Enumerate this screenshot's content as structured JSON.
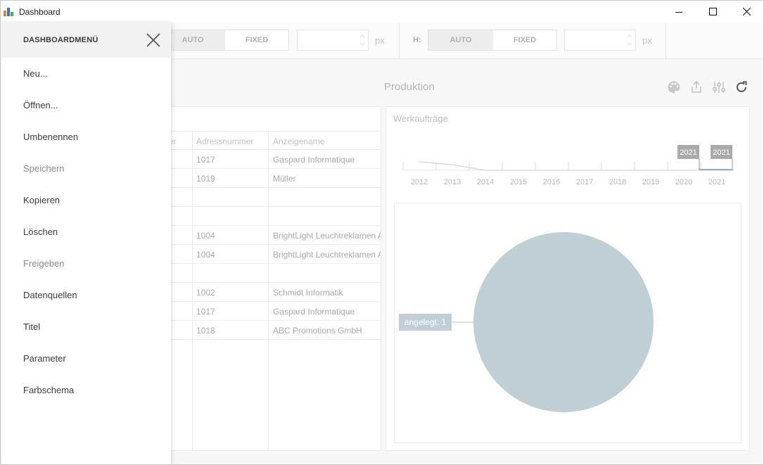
{
  "window": {
    "title": "Dashboard"
  },
  "toolbar": {
    "width_auto": "AUTO",
    "width_fixed": "FIXED",
    "width_px": "px",
    "height_label": "H:",
    "height_auto": "AUTO",
    "height_fixed": "FIXED",
    "height_px": "px"
  },
  "dashboard": {
    "title": "Produktion",
    "actions": [
      "palette-icon",
      "export-icon",
      "parameters-icon",
      "refresh-icon"
    ]
  },
  "grid": {
    "columns": [
      "er",
      "Adressnummer",
      "Anzeigename"
    ],
    "rows": [
      [
        "1017",
        "Gaspard Informatique"
      ],
      [
        "1019",
        "Müller"
      ],
      [
        "",
        ""
      ],
      [
        "",
        ""
      ],
      [
        "1004",
        "BrightLight Leuchtreklamen A"
      ],
      [
        "1004",
        "BrightLight Leuchtreklamen A"
      ],
      [
        "",
        ""
      ],
      [
        "1002",
        "Schmidt Informatik"
      ],
      [
        "1017",
        "Gaspard Informatique"
      ],
      [
        "1018",
        "ABC Promotions GmbH"
      ]
    ]
  },
  "chart": {
    "title": "Werkaufträge"
  },
  "chart_data": [
    {
      "type": "line",
      "x": [
        "2012",
        "2013",
        "2014",
        "2015",
        "2016",
        "2017",
        "2018",
        "2019",
        "2020",
        "2021"
      ],
      "range_labels": [
        "2021",
        "2021"
      ],
      "colors": {
        "line": "#d0d5d8",
        "selection": "#7a9fb3",
        "label_bg": "#aaaaaa"
      }
    },
    {
      "type": "pie",
      "slices": [
        {
          "label": "angelegt: 1",
          "value": 1
        }
      ],
      "colors": {
        "slice": "#c0cfd3",
        "label_bg": "#c0cfd3"
      }
    }
  ],
  "side_menu": {
    "title": "DASHBOARDMENÜ",
    "items": [
      {
        "label": "Neu...",
        "enabled": true
      },
      {
        "label": "Öffnen...",
        "enabled": true
      },
      {
        "label": "Umbenennen",
        "enabled": true
      },
      {
        "label": "Speichern",
        "enabled": false
      },
      {
        "label": "Kopieren",
        "enabled": true
      },
      {
        "label": "Löschen",
        "enabled": true
      },
      {
        "label": "Freigeben",
        "enabled": false
      },
      {
        "label": "Datenquellen",
        "enabled": true
      },
      {
        "label": "Titel",
        "enabled": true
      },
      {
        "label": "Parameter",
        "enabled": true
      },
      {
        "label": "Farbschema",
        "enabled": true
      }
    ]
  }
}
